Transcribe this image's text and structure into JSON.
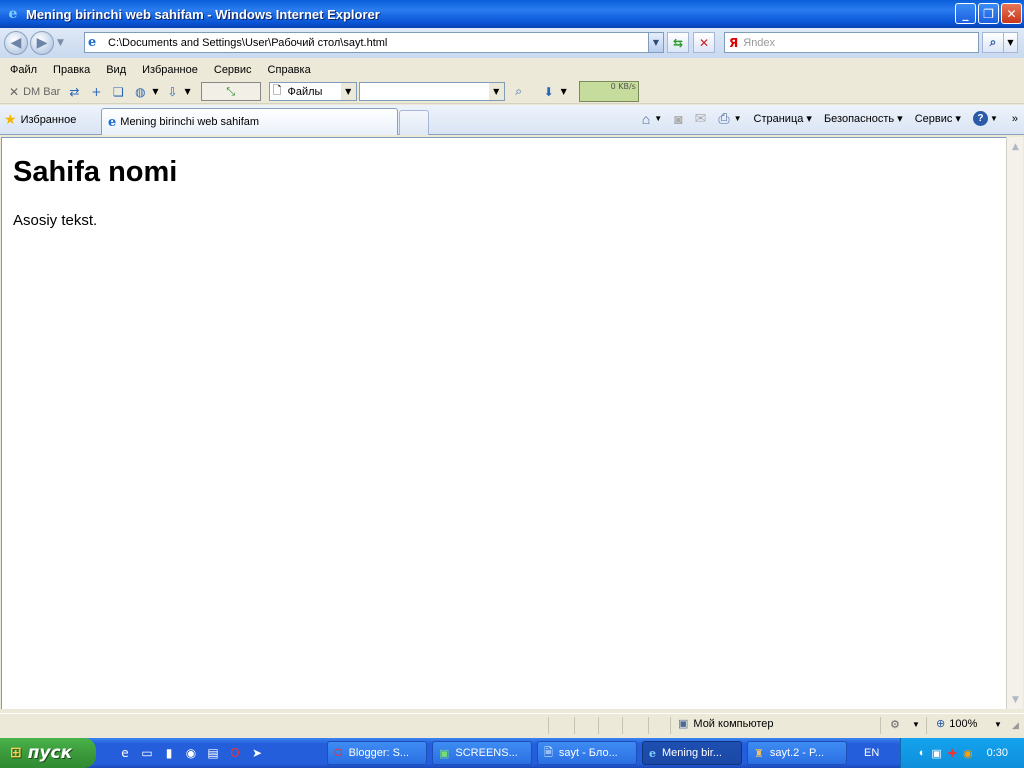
{
  "window": {
    "title": "Mening birinchi web sahifam - Windows Internet Explorer"
  },
  "address_bar": {
    "url": "C:\\Documents and Settings\\User\\Рабочий стол\\sayt.html"
  },
  "search": {
    "brand": "Я",
    "placeholder": "Яndex"
  },
  "menu": [
    "Файл",
    "Правка",
    "Вид",
    "Избранное",
    "Сервис",
    "Справка"
  ],
  "toolbar": {
    "dm_bar": "DM Bar",
    "files_label": "Файлы",
    "speed": "0 KB/s"
  },
  "favorites": {
    "label": "Избранное"
  },
  "tab": {
    "title": "Mening birinchi web sahifam"
  },
  "command_bar": {
    "page": "Страница",
    "safety": "Безопасность",
    "tools": "Сервис"
  },
  "page": {
    "heading": "Sahifa nomi",
    "body": "Asosiy tekst."
  },
  "status": {
    "zone": "Мой компьютер",
    "zoom": "100%"
  },
  "taskbar": {
    "start": "пуск",
    "tasks": [
      "Blogger: S...",
      "SCREENS...",
      "sayt - Бло...",
      "Mening bir...",
      "sayt.2 - P..."
    ],
    "lang": "EN",
    "clock": "0:30"
  },
  "colors": {
    "titlebar": "#0a5fd8",
    "taskbar": "#245edb",
    "start": "#3c9b3d",
    "tray": "#0f8fdc"
  }
}
